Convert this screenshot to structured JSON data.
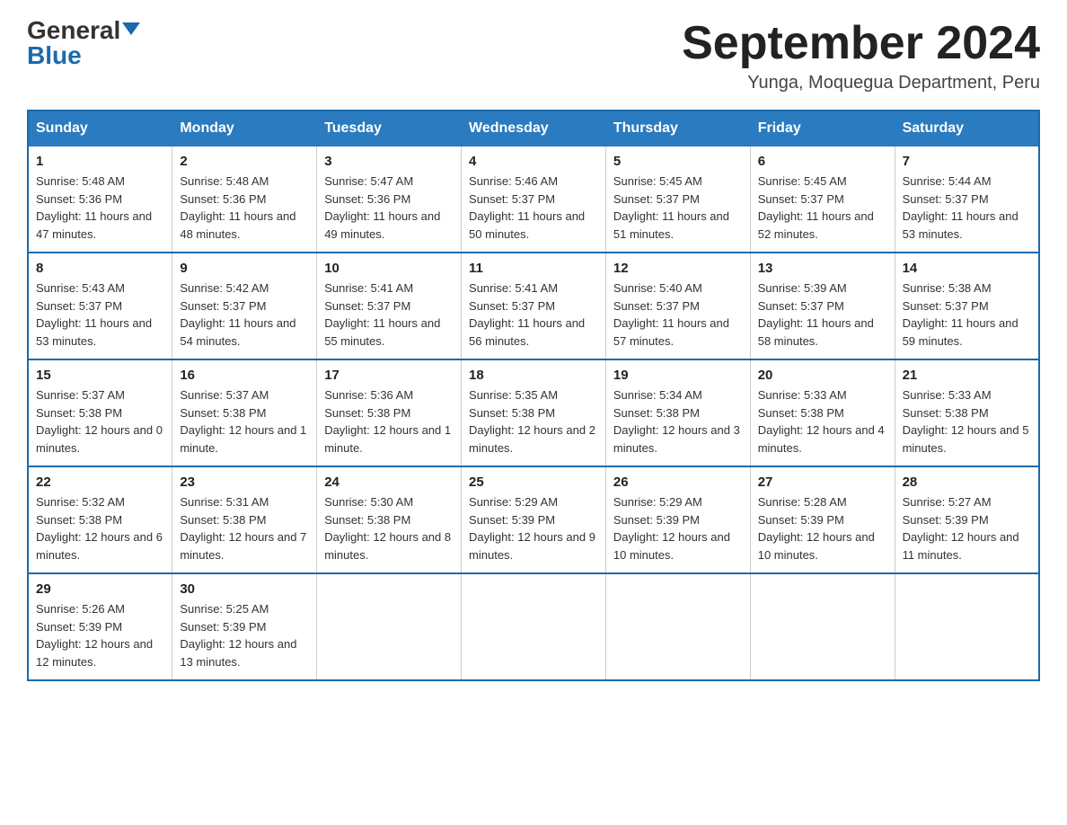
{
  "header": {
    "logo_general": "General",
    "logo_blue": "Blue",
    "title": "September 2024",
    "location": "Yunga, Moquegua Department, Peru"
  },
  "days_of_week": [
    "Sunday",
    "Monday",
    "Tuesday",
    "Wednesday",
    "Thursday",
    "Friday",
    "Saturday"
  ],
  "weeks": [
    [
      {
        "day": "1",
        "sunrise": "5:48 AM",
        "sunset": "5:36 PM",
        "daylight": "11 hours and 47 minutes."
      },
      {
        "day": "2",
        "sunrise": "5:48 AM",
        "sunset": "5:36 PM",
        "daylight": "11 hours and 48 minutes."
      },
      {
        "day": "3",
        "sunrise": "5:47 AM",
        "sunset": "5:36 PM",
        "daylight": "11 hours and 49 minutes."
      },
      {
        "day": "4",
        "sunrise": "5:46 AM",
        "sunset": "5:37 PM",
        "daylight": "11 hours and 50 minutes."
      },
      {
        "day": "5",
        "sunrise": "5:45 AM",
        "sunset": "5:37 PM",
        "daylight": "11 hours and 51 minutes."
      },
      {
        "day": "6",
        "sunrise": "5:45 AM",
        "sunset": "5:37 PM",
        "daylight": "11 hours and 52 minutes."
      },
      {
        "day": "7",
        "sunrise": "5:44 AM",
        "sunset": "5:37 PM",
        "daylight": "11 hours and 53 minutes."
      }
    ],
    [
      {
        "day": "8",
        "sunrise": "5:43 AM",
        "sunset": "5:37 PM",
        "daylight": "11 hours and 53 minutes."
      },
      {
        "day": "9",
        "sunrise": "5:42 AM",
        "sunset": "5:37 PM",
        "daylight": "11 hours and 54 minutes."
      },
      {
        "day": "10",
        "sunrise": "5:41 AM",
        "sunset": "5:37 PM",
        "daylight": "11 hours and 55 minutes."
      },
      {
        "day": "11",
        "sunrise": "5:41 AM",
        "sunset": "5:37 PM",
        "daylight": "11 hours and 56 minutes."
      },
      {
        "day": "12",
        "sunrise": "5:40 AM",
        "sunset": "5:37 PM",
        "daylight": "11 hours and 57 minutes."
      },
      {
        "day": "13",
        "sunrise": "5:39 AM",
        "sunset": "5:37 PM",
        "daylight": "11 hours and 58 minutes."
      },
      {
        "day": "14",
        "sunrise": "5:38 AM",
        "sunset": "5:37 PM",
        "daylight": "11 hours and 59 minutes."
      }
    ],
    [
      {
        "day": "15",
        "sunrise": "5:37 AM",
        "sunset": "5:38 PM",
        "daylight": "12 hours and 0 minutes."
      },
      {
        "day": "16",
        "sunrise": "5:37 AM",
        "sunset": "5:38 PM",
        "daylight": "12 hours and 1 minute."
      },
      {
        "day": "17",
        "sunrise": "5:36 AM",
        "sunset": "5:38 PM",
        "daylight": "12 hours and 1 minute."
      },
      {
        "day": "18",
        "sunrise": "5:35 AM",
        "sunset": "5:38 PM",
        "daylight": "12 hours and 2 minutes."
      },
      {
        "day": "19",
        "sunrise": "5:34 AM",
        "sunset": "5:38 PM",
        "daylight": "12 hours and 3 minutes."
      },
      {
        "day": "20",
        "sunrise": "5:33 AM",
        "sunset": "5:38 PM",
        "daylight": "12 hours and 4 minutes."
      },
      {
        "day": "21",
        "sunrise": "5:33 AM",
        "sunset": "5:38 PM",
        "daylight": "12 hours and 5 minutes."
      }
    ],
    [
      {
        "day": "22",
        "sunrise": "5:32 AM",
        "sunset": "5:38 PM",
        "daylight": "12 hours and 6 minutes."
      },
      {
        "day": "23",
        "sunrise": "5:31 AM",
        "sunset": "5:38 PM",
        "daylight": "12 hours and 7 minutes."
      },
      {
        "day": "24",
        "sunrise": "5:30 AM",
        "sunset": "5:38 PM",
        "daylight": "12 hours and 8 minutes."
      },
      {
        "day": "25",
        "sunrise": "5:29 AM",
        "sunset": "5:39 PM",
        "daylight": "12 hours and 9 minutes."
      },
      {
        "day": "26",
        "sunrise": "5:29 AM",
        "sunset": "5:39 PM",
        "daylight": "12 hours and 10 minutes."
      },
      {
        "day": "27",
        "sunrise": "5:28 AM",
        "sunset": "5:39 PM",
        "daylight": "12 hours and 10 minutes."
      },
      {
        "day": "28",
        "sunrise": "5:27 AM",
        "sunset": "5:39 PM",
        "daylight": "12 hours and 11 minutes."
      }
    ],
    [
      {
        "day": "29",
        "sunrise": "5:26 AM",
        "sunset": "5:39 PM",
        "daylight": "12 hours and 12 minutes."
      },
      {
        "day": "30",
        "sunrise": "5:25 AM",
        "sunset": "5:39 PM",
        "daylight": "12 hours and 13 minutes."
      },
      null,
      null,
      null,
      null,
      null
    ]
  ]
}
